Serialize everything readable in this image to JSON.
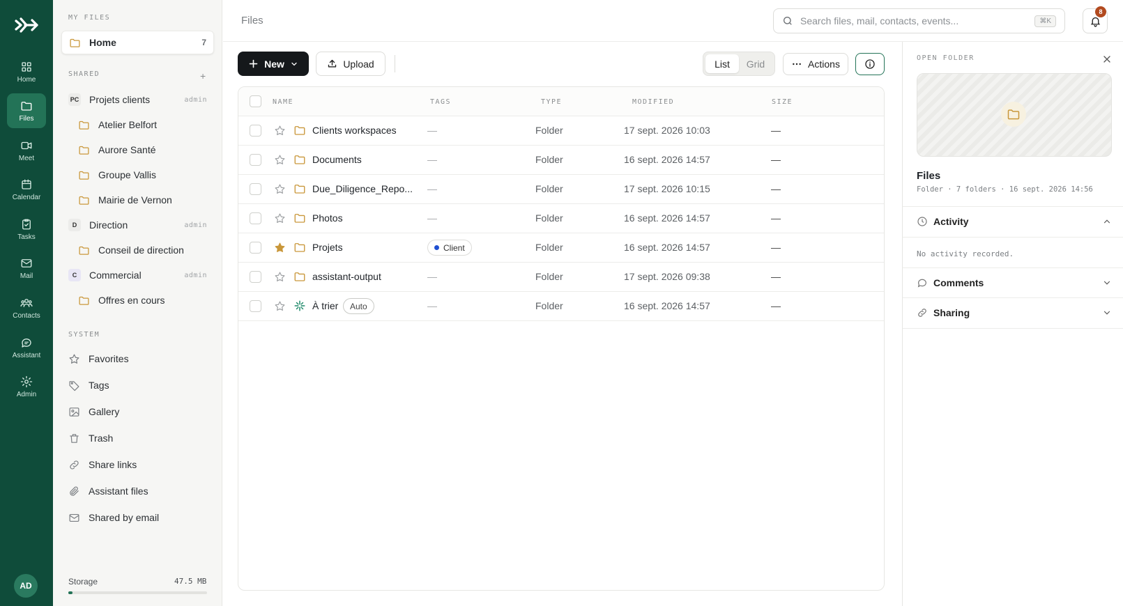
{
  "rail": {
    "items": [
      {
        "label": "Home",
        "icon": "home-grid-icon",
        "active": false
      },
      {
        "label": "Files",
        "icon": "folder-icon",
        "active": true
      },
      {
        "label": "Meet",
        "icon": "video-icon",
        "active": false
      },
      {
        "label": "Calendar",
        "icon": "calendar-icon",
        "active": false
      },
      {
        "label": "Tasks",
        "icon": "clipboard-check-icon",
        "active": false
      },
      {
        "label": "Mail",
        "icon": "mail-icon",
        "active": false
      },
      {
        "label": "Contacts",
        "icon": "users-icon",
        "active": false
      },
      {
        "label": "Assistant",
        "icon": "chat-bubble-icon",
        "active": false
      },
      {
        "label": "Admin",
        "icon": "gear-icon",
        "active": false
      }
    ],
    "avatar": "AD"
  },
  "sidebar": {
    "my_files_title": "MY FILES",
    "home": {
      "label": "Home",
      "count": "7"
    },
    "shared_title": "SHARED",
    "shared_add": "+",
    "groups": [
      {
        "badge": "PC",
        "name": "Projets clients",
        "role": "admin",
        "badge_color": "#ececea",
        "children": [
          "Atelier Belfort",
          "Aurore Santé",
          "Groupe Vallis",
          "Mairie de Vernon"
        ]
      },
      {
        "badge": "D",
        "name": "Direction",
        "role": "admin",
        "badge_color": "#ececea",
        "children": [
          "Conseil de direction"
        ]
      },
      {
        "badge": "C",
        "name": "Commercial",
        "role": "admin",
        "badge_color": "#e8e6f5",
        "children": [
          "Offres en cours"
        ]
      }
    ],
    "system_title": "SYSTEM",
    "system": [
      {
        "label": "Favorites",
        "icon": "star-icon"
      },
      {
        "label": "Tags",
        "icon": "tag-icon"
      },
      {
        "label": "Gallery",
        "icon": "image-icon"
      },
      {
        "label": "Trash",
        "icon": "trash-icon"
      },
      {
        "label": "Share links",
        "icon": "link-icon"
      },
      {
        "label": "Assistant files",
        "icon": "paperclip-icon"
      },
      {
        "label": "Shared by email",
        "icon": "mail-icon"
      }
    ],
    "storage": {
      "label": "Storage",
      "value": "47.5 MB",
      "fill_fraction": 0.03
    }
  },
  "topbar": {
    "breadcrumb": "Files",
    "search_placeholder": "Search files, mail, contacts, events...",
    "search_shortcut": "⌘K",
    "notifications": "8"
  },
  "toolbar": {
    "new_label": "New",
    "upload_label": "Upload",
    "view_list": "List",
    "view_grid": "Grid",
    "actions_label": "Actions"
  },
  "table": {
    "columns": [
      "NAME",
      "TAGS",
      "TYPE",
      "MODIFIED",
      "SIZE"
    ],
    "rows": [
      {
        "name": "Clients workspaces",
        "tag": "—",
        "type": "Folder",
        "modified": "17 sept. 2026 10:03",
        "size": "—",
        "starred": false,
        "icon": "folder-icon"
      },
      {
        "name": "Documents",
        "tag": "—",
        "type": "Folder",
        "modified": "16 sept. 2026 14:57",
        "size": "—",
        "starred": false,
        "icon": "folder-icon"
      },
      {
        "name": "Due_Diligence_Repo...",
        "tag": "—",
        "type": "Folder",
        "modified": "17 sept. 2026 10:15",
        "size": "—",
        "starred": false,
        "icon": "folder-icon"
      },
      {
        "name": "Photos",
        "tag": "—",
        "type": "Folder",
        "modified": "16 sept. 2026 14:57",
        "size": "—",
        "starred": false,
        "icon": "folder-icon"
      },
      {
        "name": "Projets",
        "tag": "Client",
        "type": "Folder",
        "modified": "16 sept. 2026 14:57",
        "size": "—",
        "starred": true,
        "icon": "folder-icon"
      },
      {
        "name": "assistant-output",
        "tag": "—",
        "type": "Folder",
        "modified": "17 sept. 2026 09:38",
        "size": "—",
        "starred": false,
        "icon": "folder-icon"
      },
      {
        "name": "À trier",
        "badge": "Auto",
        "tag": "—",
        "type": "Folder",
        "modified": "16 sept. 2026 14:57",
        "size": "—",
        "starred": false,
        "icon": "sparkle-icon"
      }
    ]
  },
  "panel": {
    "title": "OPEN FOLDER",
    "name": "Files",
    "meta": "Folder · 7 folders · 16 sept. 2026 14:56",
    "activity_label": "Activity",
    "activity_empty": "No activity recorded.",
    "comments_label": "Comments",
    "sharing_label": "Sharing"
  },
  "colors": {
    "rail": "#0f4c3a",
    "accent": "#237357",
    "folder": "#c9973a",
    "star": "#c9973a",
    "tag_dot": "#1f4fd1",
    "badge": "#b24a1f"
  }
}
